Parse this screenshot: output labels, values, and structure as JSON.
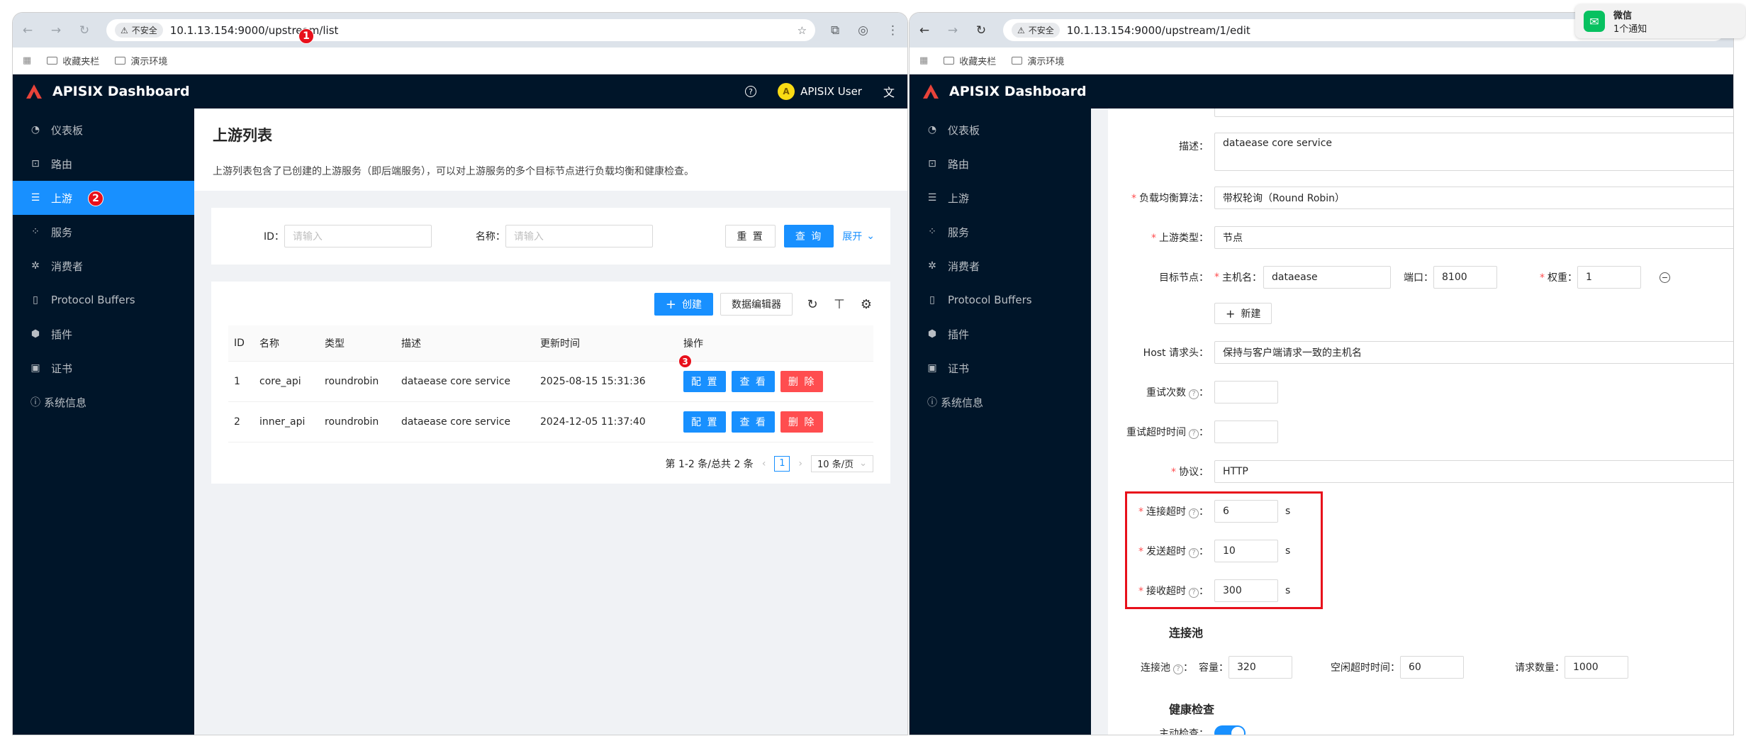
{
  "left_browser": {
    "insecure_label": "不安全",
    "url": "10.1.13.154:9000/upstream/list",
    "bookmarks": [
      "收藏夹栏",
      "演示环境"
    ]
  },
  "right_browser": {
    "insecure_label": "不安全",
    "url": "10.1.13.154:9000/upstream/1/edit",
    "bookmarks": [
      "收藏夹栏",
      "演示环境"
    ]
  },
  "notification": {
    "app": "微信",
    "text": "1个通知"
  },
  "app": {
    "title": "APISIX Dashboard",
    "user": "APISIX User",
    "accent": "#1890ff",
    "sider_bg": "#001529"
  },
  "menu": [
    {
      "label": "仪表板",
      "icon": "dashboard-icon"
    },
    {
      "label": "路由",
      "icon": "route-icon"
    },
    {
      "label": "上游",
      "icon": "upstream-icon"
    },
    {
      "label": "服务",
      "icon": "service-icon"
    },
    {
      "label": "消费者",
      "icon": "consumer-icon"
    },
    {
      "label": "Protocol Buffers",
      "icon": "file-icon"
    },
    {
      "label": "插件",
      "icon": "plugin-icon"
    },
    {
      "label": "证书",
      "icon": "certificate-icon"
    },
    {
      "label": "系统信息",
      "icon": "info-icon"
    }
  ],
  "list_page": {
    "title": "上游列表",
    "description": "上游列表包含了已创建的上游服务（即后端服务），可以对上游服务的多个目标节点进行负载均衡和健康检查。",
    "search": {
      "id_label": "ID：",
      "id_placeholder": "请输入",
      "name_label": "名称：",
      "name_placeholder": "请输入",
      "reset": "重 置",
      "query": "查 询",
      "expand": "展开"
    },
    "toolbar": {
      "create": "创建",
      "editor": "数据编辑器"
    },
    "columns": [
      "ID",
      "名称",
      "类型",
      "描述",
      "更新时间",
      "操作"
    ],
    "rows": [
      {
        "id": "1",
        "name": "core_api",
        "type": "roundrobin",
        "desc": "dataease core service",
        "updated": "2025-08-15 15:31:36"
      },
      {
        "id": "2",
        "name": "inner_api",
        "type": "roundrobin",
        "desc": "dataease core service",
        "updated": "2024-12-05 11:37:40"
      }
    ],
    "actions": {
      "config": "配 置",
      "view": "查 看",
      "delete": "删 除"
    },
    "pagination": {
      "summary": "第 1-2 条/总共 2 条",
      "current": "1",
      "page_size": "10 条/页"
    }
  },
  "edit_page": {
    "desc_label": "描述：",
    "desc_value": "dataease core service",
    "lb_label": "负载均衡算法：",
    "lb_value": "带权轮询（Round Robin）",
    "type_label": "上游类型：",
    "type_value": "节点",
    "nodes_label": "目标节点：",
    "host_label": "主机名：",
    "host_value": "dataease",
    "port_label": "端口：",
    "port_value": "8100",
    "weight_label": "权重：",
    "weight_value": "1",
    "add_node": "新建",
    "host_header_label": "Host 请求头：",
    "host_header_value": "保持与客户端请求一致的主机名",
    "retries_label": "重试次数",
    "retry_timeout_label": "重试超时时间",
    "scheme_label": "协议：",
    "scheme_value": "HTTP",
    "connect_label": "连接超时",
    "connect_value": "6",
    "send_label": "发送超时",
    "send_value": "10",
    "read_label": "接收超时",
    "read_value": "300",
    "unit": "s",
    "pool_section": "连接池",
    "pool_label": "连接池",
    "size_label": "容量：",
    "size_value": "320",
    "idle_label": "空闲超时时间：",
    "idle_value": "60",
    "requests_label": "请求数量：",
    "requests_value": "1000",
    "health_section": "健康检查",
    "active_check_label": "主动检查："
  },
  "badges": [
    "1",
    "2",
    "3"
  ]
}
